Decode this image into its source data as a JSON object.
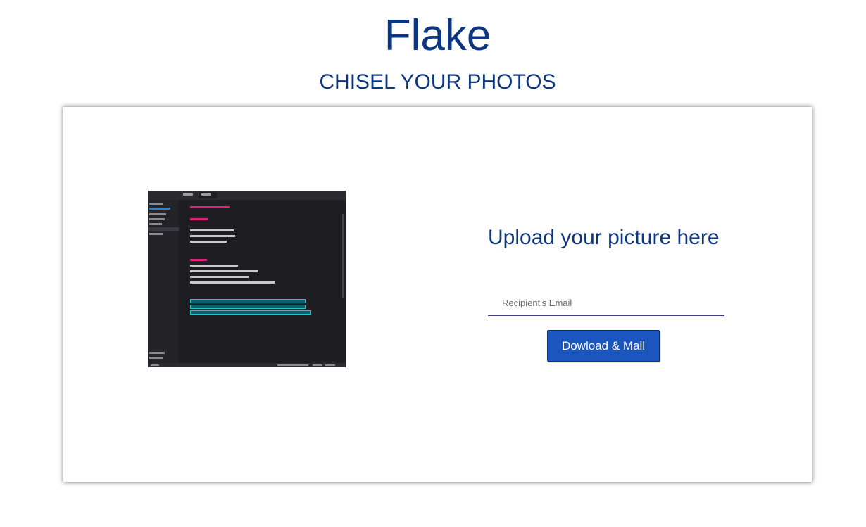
{
  "header": {
    "title": "Flake",
    "tagline": "CHISEL YOUR PHOTOS"
  },
  "upload": {
    "heading": "Upload your picture here",
    "email_placeholder": "Recipient's Email",
    "email_value": "",
    "submit_label": "Dowload & Mail"
  },
  "preview": {
    "description_icon": "uploaded-image-preview"
  },
  "colors": {
    "brand_text": "#0d3680",
    "button_bg": "#1b56bf",
    "input_underline": "#3d3e8c"
  }
}
